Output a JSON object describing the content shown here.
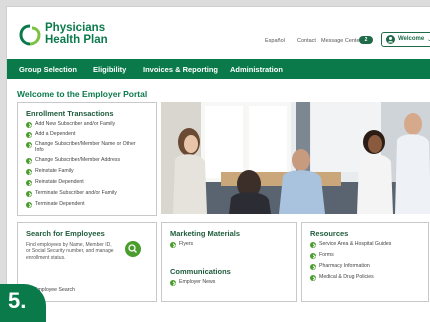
{
  "header": {
    "logo_line1": "Physicians",
    "logo_line2": "Health Plan",
    "links": [
      "Español",
      "Contact",
      "Message Center"
    ],
    "message_count": "2",
    "welcome_label": "Welcome"
  },
  "nav": {
    "items": [
      "Group Selection",
      "Eligibility",
      "Invoices & Reporting",
      "Administration"
    ]
  },
  "page_title": "Welcome to the Employer Portal",
  "enrollment": {
    "title": "Enrollment Transactions",
    "items": [
      "Add New Subscriber and/or Family",
      "Add a Dependent",
      "Change Subscriber/Member Name or Other",
      "Info",
      "Change Subscriber/Member Address",
      "Reinstate Family",
      "Reinstate Dependent",
      "Terminate Subscriber and/or Family",
      "Terminate Dependent"
    ]
  },
  "search": {
    "title": "Search for Employees",
    "desc_lines": [
      "Find employees by Name, Member ID,",
      "or Social Security number, and manage",
      "enrollment status."
    ],
    "link": "Employee Search"
  },
  "marketing": {
    "title": "Marketing Materials",
    "items": [
      "Flyers"
    ]
  },
  "communications": {
    "title": "Communications",
    "items": [
      "Employer News"
    ]
  },
  "resources": {
    "title": "Resources",
    "items": [
      "Service Area & Hospital Guides",
      "Forms",
      "Pharmacy Information",
      "Medical & Drug Policies"
    ]
  },
  "step_badge": "5.",
  "colors": {
    "brand_green": "#0b7a4b",
    "accent_green": "#4a9c2d",
    "dark_green": "#1f6b49"
  }
}
